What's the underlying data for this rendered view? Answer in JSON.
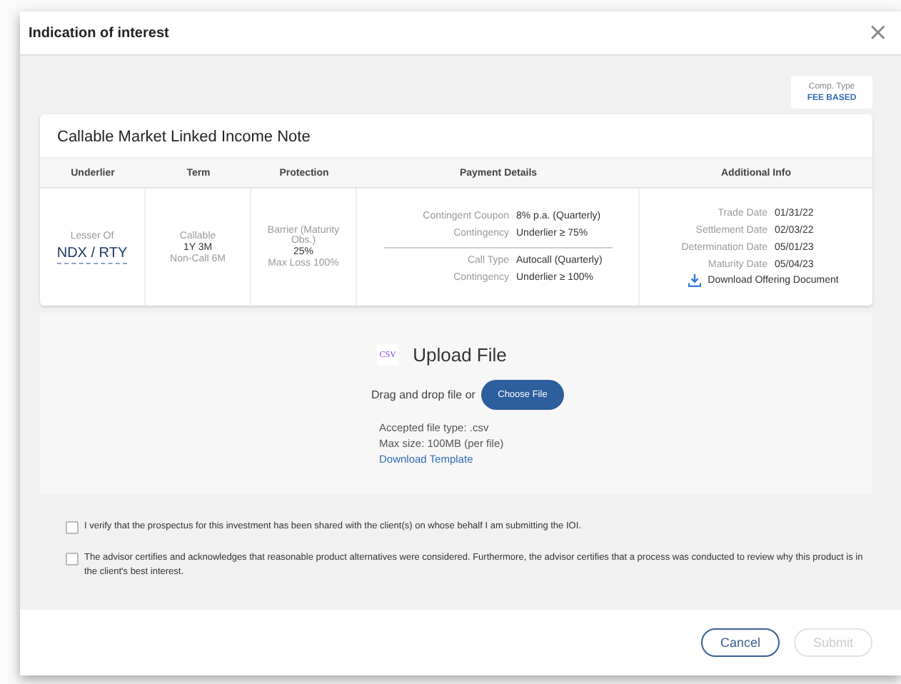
{
  "window": {
    "title": "Indication of interest",
    "close": "×"
  },
  "comp_type": {
    "label": "Comp. Type",
    "value": "FEE BASED"
  },
  "product": {
    "title": "Callable Market Linked Income Note",
    "columns": [
      "Underlier",
      "Term",
      "Protection",
      "Payment Details",
      "Additional Info"
    ],
    "underlier": {
      "prefix": "Lesser Of",
      "value": "NDX / RTY"
    },
    "term": [
      {
        "text": "Callable",
        "kind": "label"
      },
      {
        "text": "1Y 3M",
        "kind": "value"
      },
      {
        "text": "Non-Call 6M",
        "kind": "label"
      }
    ],
    "protection": [
      {
        "text": "Barrier (Maturity Obs.)",
        "kind": "label"
      },
      {
        "text": "25%",
        "kind": "value"
      },
      {
        "text": "Max Loss 100%",
        "kind": "label"
      }
    ],
    "payment_details": [
      [
        {
          "label": "Contingent Coupon",
          "value": "8% p.a. (Quarterly)"
        },
        {
          "label": "Contingency",
          "value": "Underlier ≥ 75%"
        }
      ],
      [
        {
          "label": "Call Type",
          "value": "Autocall (Quarterly)"
        },
        {
          "label": "Contingency",
          "value": "Underlier ≥ 100%"
        }
      ]
    ],
    "additional_info": [
      {
        "label": "Trade Date",
        "value": "01/31/22"
      },
      {
        "label": "Settlement Date",
        "value": "02/03/22"
      },
      {
        "label": "Determination Date",
        "value": "05/01/23"
      },
      {
        "label": "Maturity Date",
        "value": "05/04/23"
      }
    ],
    "download_link": "Download Offering Document"
  },
  "upload": {
    "badge": "CSV",
    "title": "Upload File",
    "prompt": "Drag and drop file or",
    "button": "Choose File",
    "accepted": "Accepted file type: .csv",
    "max_size": "Max size: 100MB (per file)",
    "template_link": "Download Template"
  },
  "agreements": [
    {
      "text": "I verify that the prospectus for this investment has been shared with the client(s) on whose behalf I am submitting the IOI.",
      "checked": false
    },
    {
      "text": "The advisor certifies and acknowledges that reasonable product alternatives were considered. Furthermore, the advisor certifies that a process was conducted to review why this product is in the client's best interest.",
      "checked": false
    }
  ],
  "buttons": [
    {
      "label": "Cancel",
      "disabled": false
    },
    {
      "label": "Submit",
      "disabled": true
    }
  ]
}
